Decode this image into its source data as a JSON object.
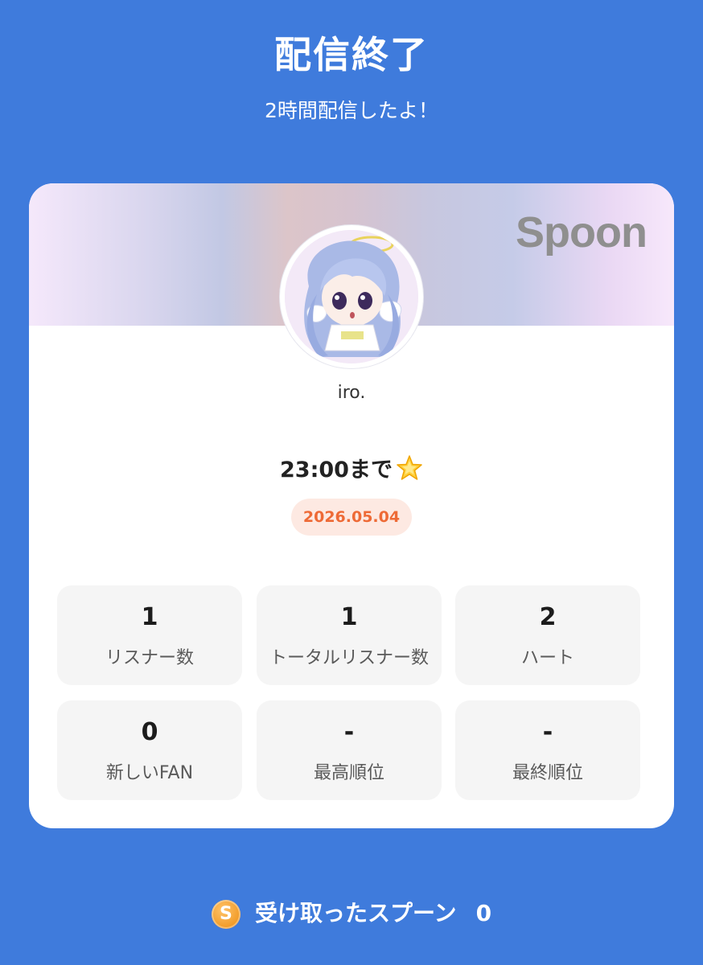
{
  "header": {
    "title": "配信終了",
    "subtitle": "2時間配信したよ！"
  },
  "card": {
    "brand": "Spoon",
    "username": "iro.",
    "caption": "23:00まで",
    "caption_emoji": "star-icon",
    "date": "2026.05.04",
    "stats": [
      {
        "value": "1",
        "label": "リスナー数"
      },
      {
        "value": "1",
        "label": "トータルリスナー数"
      },
      {
        "value": "2",
        "label": "ハート"
      },
      {
        "value": "0",
        "label": "新しいFAN"
      },
      {
        "value": "-",
        "label": "最高順位"
      },
      {
        "value": "-",
        "label": "最終順位"
      }
    ]
  },
  "footer": {
    "coin_letter": "S",
    "label": "受け取ったスプーン",
    "count": "0"
  },
  "colors": {
    "background": "#3f7bdc",
    "date_text": "#ee6a36",
    "date_bg": "#fde9e2",
    "coin": "#f19a26"
  }
}
